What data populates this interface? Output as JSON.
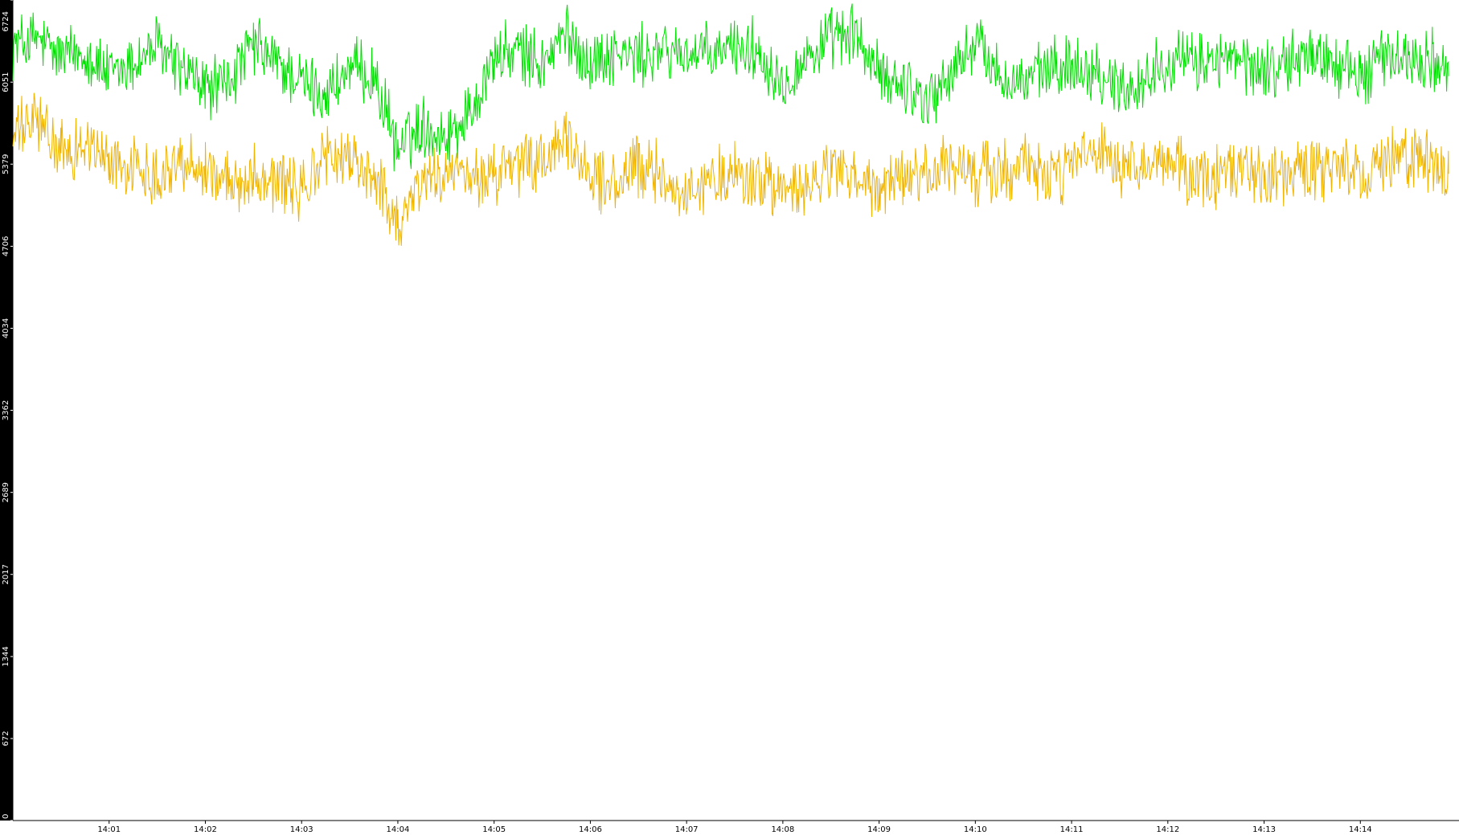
{
  "chart_data": {
    "type": "line",
    "title": "",
    "xlabel": "",
    "ylabel": "",
    "grid": false,
    "legend": "none",
    "colors": {
      "background": "#000000",
      "plot": "#ffffff",
      "axis_text_y": "#ffffff",
      "axis_text_x": "#000000"
    },
    "ylim": [
      0,
      6724
    ],
    "y_ticks": [
      0,
      672,
      1344,
      2017,
      2689,
      3362,
      4034,
      4706,
      5379,
      6051,
      6724
    ],
    "xlim": [
      "14:00:00",
      "14:15:00"
    ],
    "x_ticks": [
      "14:01",
      "14:02",
      "14:03",
      "14:04",
      "14:05",
      "14:06",
      "14:07",
      "14:08",
      "14:09",
      "14:10",
      "14:11",
      "14:12",
      "14:13",
      "14:14"
    ],
    "series": [
      {
        "color": "#00e000",
        "x": [
          "14:00:00",
          "14:00:15",
          "14:00:30",
          "14:00:45",
          "14:01:00",
          "14:01:15",
          "14:01:30",
          "14:01:45",
          "14:02:00",
          "14:02:15",
          "14:02:30",
          "14:02:45",
          "14:03:00",
          "14:03:15",
          "14:03:30",
          "14:03:45",
          "14:04:00",
          "14:04:15",
          "14:04:30",
          "14:04:45",
          "14:05:00",
          "14:05:15",
          "14:05:30",
          "14:05:45",
          "14:06:00",
          "14:06:15",
          "14:06:30",
          "14:06:45",
          "14:07:00",
          "14:07:15",
          "14:07:30",
          "14:07:45",
          "14:08:00",
          "14:08:15",
          "14:08:30",
          "14:08:45",
          "14:09:00",
          "14:09:15",
          "14:09:30",
          "14:09:45",
          "14:10:00",
          "14:10:15",
          "14:10:30",
          "14:10:45",
          "14:11:00",
          "14:11:15",
          "14:11:30",
          "14:11:45",
          "14:12:00",
          "14:12:15",
          "14:12:30",
          "14:12:45",
          "14:13:00",
          "14:13:15",
          "14:13:30",
          "14:13:45",
          "14:14:00",
          "14:14:15",
          "14:14:30",
          "14:14:45",
          "14:14:55"
        ],
        "values": [
          6350,
          6400,
          6250,
          6300,
          6100,
          6200,
          6350,
          6150,
          6000,
          6050,
          6350,
          6200,
          6050,
          5950,
          6150,
          6100,
          5500,
          5700,
          5600,
          5800,
          6250,
          6300,
          6200,
          6450,
          6200,
          6300,
          6250,
          6300,
          6300,
          6250,
          6350,
          6300,
          6050,
          6250,
          6400,
          6450,
          6100,
          6050,
          5900,
          6100,
          6400,
          6100,
          6050,
          6150,
          6200,
          6150,
          6000,
          6050,
          6250,
          6200,
          6250,
          6200,
          6150,
          6200,
          6300,
          6200,
          6100,
          6250,
          6250,
          6250,
          6100
        ]
      },
      {
        "color": "#f0b400",
        "x": [
          "14:00:00",
          "14:00:15",
          "14:00:30",
          "14:00:45",
          "14:01:00",
          "14:01:15",
          "14:01:30",
          "14:01:45",
          "14:02:00",
          "14:02:15",
          "14:02:30",
          "14:02:45",
          "14:03:00",
          "14:03:15",
          "14:03:30",
          "14:03:45",
          "14:04:00",
          "14:04:15",
          "14:04:30",
          "14:04:45",
          "14:05:00",
          "14:05:15",
          "14:05:30",
          "14:05:45",
          "14:06:00",
          "14:06:15",
          "14:06:30",
          "14:06:45",
          "14:07:00",
          "14:07:15",
          "14:07:30",
          "14:07:45",
          "14:08:00",
          "14:08:15",
          "14:08:30",
          "14:08:45",
          "14:09:00",
          "14:09:15",
          "14:09:30",
          "14:09:45",
          "14:10:00",
          "14:10:15",
          "14:10:30",
          "14:10:45",
          "14:11:00",
          "14:11:15",
          "14:11:30",
          "14:11:45",
          "14:12:00",
          "14:12:15",
          "14:12:30",
          "14:12:45",
          "14:13:00",
          "14:13:15",
          "14:13:30",
          "14:13:45",
          "14:14:00",
          "14:14:15",
          "14:14:30",
          "14:14:45",
          "14:14:55"
        ],
        "values": [
          5600,
          5750,
          5450,
          5550,
          5400,
          5350,
          5300,
          5400,
          5350,
          5200,
          5300,
          5250,
          5150,
          5450,
          5400,
          5300,
          4900,
          5250,
          5300,
          5250,
          5300,
          5350,
          5400,
          5550,
          5300,
          5200,
          5350,
          5300,
          5100,
          5250,
          5300,
          5250,
          5150,
          5150,
          5350,
          5250,
          5150,
          5250,
          5300,
          5350,
          5300,
          5300,
          5400,
          5250,
          5350,
          5500,
          5300,
          5300,
          5450,
          5250,
          5250,
          5350,
          5300,
          5300,
          5350,
          5300,
          5300,
          5450,
          5400,
          5400,
          5300
        ]
      }
    ]
  }
}
